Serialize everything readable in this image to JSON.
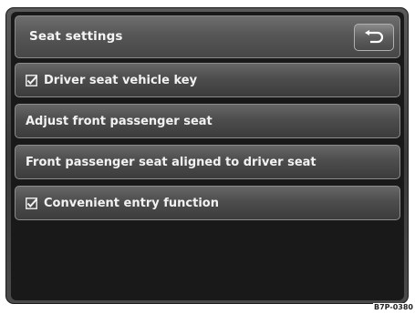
{
  "header": {
    "title": "Seat settings",
    "back_icon": "return-arrow-icon"
  },
  "items": [
    {
      "label": "Driver seat vehicle key",
      "checked": true
    },
    {
      "label": "Adjust front passenger seat",
      "checked": false
    },
    {
      "label": "Front passenger seat aligned to driver seat",
      "checked": false
    },
    {
      "label": "Convenient entry function",
      "checked": true
    }
  ],
  "figure_ref": "B7P-0380",
  "colors": {
    "screen_bg": "#191919",
    "button_top": "#676767",
    "button_bottom": "#3c3c3c",
    "text": "#f2f2f2"
  }
}
